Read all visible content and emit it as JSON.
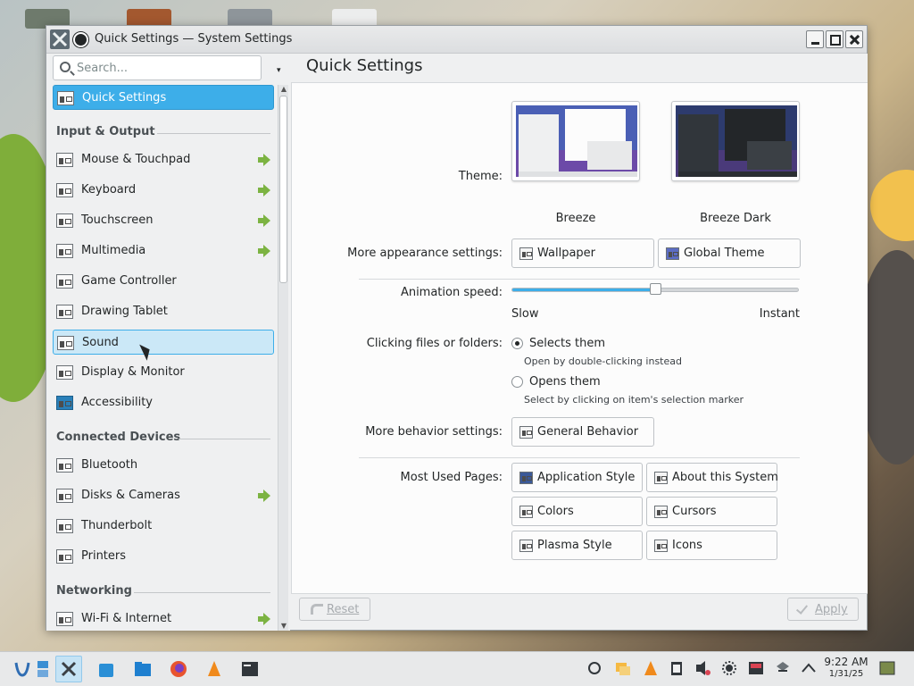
{
  "window": {
    "title": "Quick Settings — System Settings"
  },
  "search": {
    "placeholder": "Search..."
  },
  "sidebar": {
    "current": "Quick Settings",
    "sections": {
      "input_output": "Input & Output",
      "connected_devices": "Connected Devices",
      "networking": "Networking"
    },
    "items": {
      "mouse_touchpad": "Mouse & Touchpad",
      "keyboard": "Keyboard",
      "touchscreen": "Touchscreen",
      "multimedia": "Multimedia",
      "game_controller": "Game Controller",
      "drawing_tablet": "Drawing Tablet",
      "sound": "Sound",
      "display_monitor": "Display & Monitor",
      "accessibility": "Accessibility",
      "bluetooth": "Bluetooth",
      "disks_cameras": "Disks & Cameras",
      "thunderbolt": "Thunderbolt",
      "printers": "Printers",
      "wifi_internet": "Wi-Fi & Internet"
    }
  },
  "main": {
    "title": "Quick Settings",
    "theme_label": "Theme:",
    "themes": [
      "Breeze",
      "Breeze Dark"
    ],
    "appearance_label": "More appearance settings:",
    "appearance_buttons": [
      "Wallpaper",
      "Global Theme"
    ],
    "animation_label": "Animation speed:",
    "animation_slow": "Slow",
    "animation_instant": "Instant",
    "animation_value": 0.5,
    "clicking_label": "Clicking files or folders:",
    "radio_selects": "Selects them",
    "radio_selects_sub": "Open by double-clicking instead",
    "radio_opens": "Opens them",
    "radio_opens_sub": "Select by clicking on item's selection marker",
    "behavior_label": "More behavior settings:",
    "behavior_button": "General Behavior",
    "most_used_label": "Most Used Pages:",
    "most_used": [
      "Application Style",
      "About this System",
      "Colors",
      "Cursors",
      "Plasma Style",
      "Icons"
    ]
  },
  "footer": {
    "reset": "Reset",
    "apply": "Apply"
  },
  "taskbar": {
    "time": "9:22 AM",
    "date": "1/31/25"
  },
  "colors": {
    "accent": "#3daee9",
    "hover": "#cbe8f7",
    "window_bg": "#eff0f1",
    "view_bg": "#fcfcfc",
    "arrow_green": "#7cb342"
  }
}
